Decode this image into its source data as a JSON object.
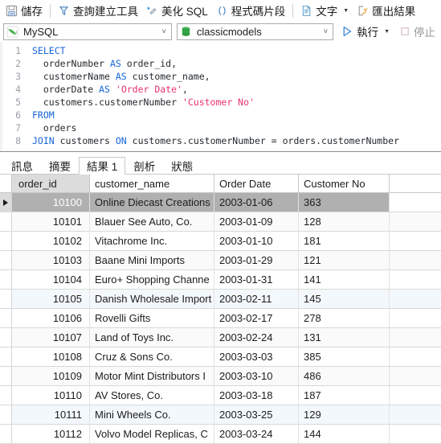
{
  "toolbar": {
    "items": [
      {
        "label": "儲存",
        "icon": "save-icon",
        "name": "save-button"
      },
      {
        "label": "查詢建立工具",
        "icon": "query-builder-icon",
        "name": "query-builder-button"
      },
      {
        "label": "美化 SQL",
        "icon": "beautify-icon",
        "name": "beautify-sql-button"
      },
      {
        "label": "程式碼片段",
        "icon": "code-snippet-icon",
        "name": "code-snippet-button"
      },
      {
        "label": "文字",
        "icon": "text-document-icon",
        "name": "text-format-button"
      },
      {
        "label": "匯出結果",
        "icon": "export-icon",
        "name": "export-results-button"
      }
    ]
  },
  "connection": {
    "driver_value": "MySQL",
    "driver_icon": "mysql-dolphin-icon",
    "database_value": "classicmodels",
    "database_icon": "database-cylinder-icon",
    "run_label": "執行",
    "run_icon": "play-triangle-icon",
    "stop_label": "停止",
    "stop_icon": "stop-square-icon"
  },
  "editor": {
    "line_numbers": [
      "1",
      "2",
      "3",
      "4",
      "5",
      "6",
      "7",
      "8"
    ],
    "lines": [
      [
        {
          "t": "SELECT",
          "c": "kw"
        }
      ],
      [
        {
          "t": "  orderNumber ",
          "c": ""
        },
        {
          "t": "AS",
          "c": "kw"
        },
        {
          "t": " order_id,",
          "c": ""
        }
      ],
      [
        {
          "t": "  customerName ",
          "c": ""
        },
        {
          "t": "AS",
          "c": "kw"
        },
        {
          "t": " customer_name,",
          "c": ""
        }
      ],
      [
        {
          "t": "  orderDate ",
          "c": ""
        },
        {
          "t": "AS",
          "c": "kw"
        },
        {
          "t": " ",
          "c": ""
        },
        {
          "t": "'Order Date'",
          "c": "str"
        },
        {
          "t": ",",
          "c": ""
        }
      ],
      [
        {
          "t": "  customers.customerNumber ",
          "c": ""
        },
        {
          "t": "'Customer No'",
          "c": "str"
        }
      ],
      [
        {
          "t": "FROM",
          "c": "kw"
        }
      ],
      [
        {
          "t": "  orders",
          "c": ""
        }
      ],
      [
        {
          "t": "JOIN",
          "c": "kw"
        },
        {
          "t": " customers ",
          "c": ""
        },
        {
          "t": "ON",
          "c": "kw"
        },
        {
          "t": " customers.customerNumber = orders.customerNumber",
          "c": ""
        }
      ]
    ]
  },
  "tabs": [
    {
      "label": "訊息",
      "active": false,
      "name": "tab-messages"
    },
    {
      "label": "摘要",
      "active": false,
      "name": "tab-summary"
    },
    {
      "label": "結果 1",
      "active": true,
      "name": "tab-result-1"
    },
    {
      "label": "剖析",
      "active": false,
      "name": "tab-profile"
    },
    {
      "label": "狀態",
      "active": false,
      "name": "tab-status"
    }
  ],
  "grid": {
    "columns": [
      "order_id",
      "customer_name",
      "Order Date",
      "Customer No"
    ],
    "rows": [
      {
        "order_id": "10100",
        "customer_name": "Online Diecast Creations",
        "order_date": "2003-01-06",
        "customer_no": "363",
        "selected": true
      },
      {
        "order_id": "10101",
        "customer_name": "Blauer See Auto, Co.",
        "order_date": "2003-01-09",
        "customer_no": "128"
      },
      {
        "order_id": "10102",
        "customer_name": "Vitachrome Inc.",
        "order_date": "2003-01-10",
        "customer_no": "181"
      },
      {
        "order_id": "10103",
        "customer_name": "Baane Mini Imports",
        "order_date": "2003-01-29",
        "customer_no": "121"
      },
      {
        "order_id": "10104",
        "customer_name": "Euro+ Shopping Channe",
        "order_date": "2003-01-31",
        "customer_no": "141"
      },
      {
        "order_id": "10105",
        "customer_name": "Danish Wholesale Import",
        "order_date": "2003-02-11",
        "customer_no": "145",
        "tint": true
      },
      {
        "order_id": "10106",
        "customer_name": "Rovelli Gifts",
        "order_date": "2003-02-17",
        "customer_no": "278"
      },
      {
        "order_id": "10107",
        "customer_name": "Land of Toys Inc.",
        "order_date": "2003-02-24",
        "customer_no": "131"
      },
      {
        "order_id": "10108",
        "customer_name": "Cruz & Sons Co.",
        "order_date": "2003-03-03",
        "customer_no": "385"
      },
      {
        "order_id": "10109",
        "customer_name": "Motor Mint Distributors I",
        "order_date": "2003-03-10",
        "customer_no": "486"
      },
      {
        "order_id": "10110",
        "customer_name": "AV Stores, Co.",
        "order_date": "2003-03-18",
        "customer_no": "187"
      },
      {
        "order_id": "10111",
        "customer_name": "Mini Wheels Co.",
        "order_date": "2003-03-25",
        "customer_no": "129",
        "tint": true
      },
      {
        "order_id": "10112",
        "customer_name": "Volvo Model Replicas, C",
        "order_date": "2003-03-24",
        "customer_no": "144"
      }
    ]
  },
  "colors": {
    "keyword_blue": "#1565d8",
    "string_pink": "#e8326a",
    "selection_gray": "#b0b0b0",
    "tint_blue": "#f3f8fd",
    "mysql_green": "#4aa746"
  }
}
